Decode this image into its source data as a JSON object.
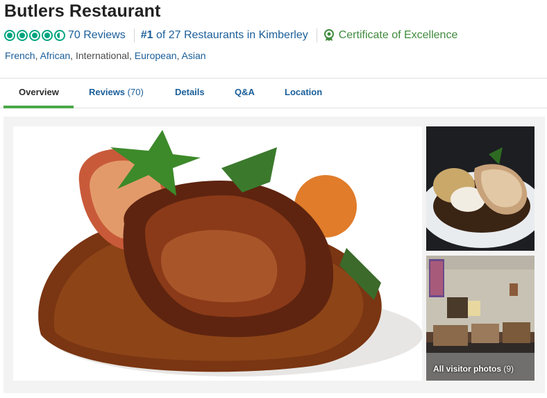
{
  "restaurant": {
    "name": "Butlers Restaurant",
    "rating": 4.5,
    "reviews_label": "70 Reviews",
    "rank_prefix": "#1",
    "rank_text": " of 27 Restaurants in Kimberley",
    "certificate": "Certificate of Excellence",
    "cuisines": [
      {
        "label": "French",
        "link": true
      },
      {
        "label": "African",
        "link": true
      },
      {
        "label": "International",
        "link": false
      },
      {
        "label": "European",
        "link": true
      },
      {
        "label": "Asian",
        "link": true
      }
    ]
  },
  "tabs": [
    {
      "label": "Overview",
      "active": true
    },
    {
      "label": "Reviews",
      "count": "(70)",
      "active": false
    },
    {
      "label": "Details",
      "active": false
    },
    {
      "label": "Q&A",
      "active": false
    },
    {
      "label": "Location",
      "active": false
    }
  ],
  "gallery": {
    "all_photos_label": "All visitor photos",
    "all_photos_count": "(9)"
  },
  "colors": {
    "accent_green": "#00a680",
    "link_blue": "#1a5e9a",
    "coe_green": "#3f8a3d",
    "tab_underline": "#4ca84a"
  }
}
